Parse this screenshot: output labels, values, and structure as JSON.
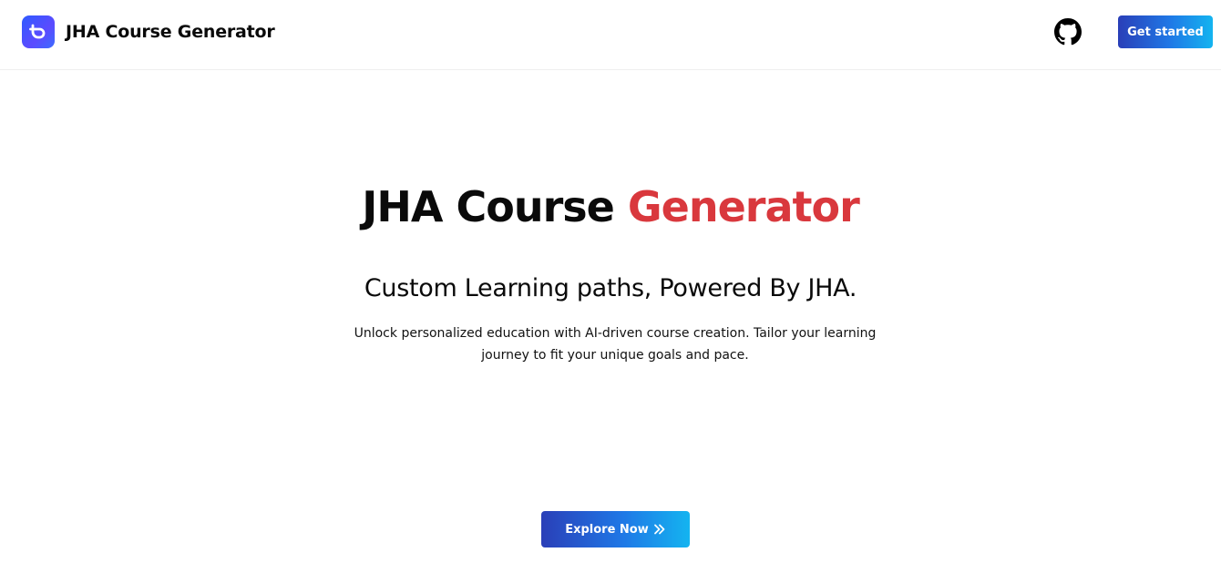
{
  "header": {
    "brand_name": "JHA Course Generator",
    "logo_icon": "logo-icon",
    "github_icon": "github-icon",
    "get_started_label": "Get started"
  },
  "hero": {
    "title_main": "JHA Course",
    "title_accent": "Generator",
    "subtitle": "Custom Learning paths, Powered By JHA.",
    "description": "Unlock personalized education with AI-driven course creation. Tailor your learning journey to fit your unique goals and pace.",
    "explore_label": "Explore Now",
    "explore_icon": "double-chevron-right-icon"
  },
  "colors": {
    "accent_red": "#d9383d",
    "button_gradient_start": "#2a3fb8",
    "button_gradient_end": "#14b4f0",
    "logo_blue": "#2f5bff"
  }
}
